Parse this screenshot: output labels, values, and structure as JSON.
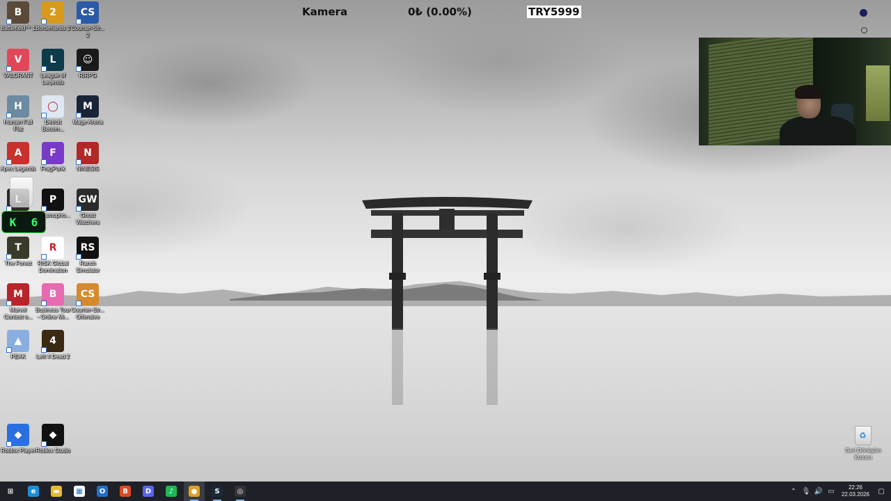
{
  "overlay": {
    "camera_label": "Kamera",
    "balance_text": "0₺ (0.00%)",
    "promo_code": "TRY5999"
  },
  "desktop_icons": [
    {
      "label": "Battlefield™ 1",
      "color": "#5b4a3a",
      "glyph": "B"
    },
    {
      "label": "Borderlands 2",
      "color": "#d89a1c",
      "glyph": "2"
    },
    {
      "label": "Counter-Str... 2",
      "color": "#2a5aa8",
      "glyph": "CS"
    },
    {
      "label": "VALORANT",
      "color": "#e0485a",
      "glyph": "V"
    },
    {
      "label": "League of Legends",
      "color": "#0d3b4a",
      "glyph": "L"
    },
    {
      "label": "RIRPG",
      "color": "#1a1a1a",
      "glyph": "☺"
    },
    {
      "label": "Human Fall Flat",
      "color": "#6c8aa0",
      "glyph": "H"
    },
    {
      "label": "Detroit Becom...",
      "color": "#dfe8f2",
      "glyph": "◯"
    },
    {
      "label": "Mage Arena",
      "color": "#1a2438",
      "glyph": "M"
    },
    {
      "label": "Apex Legends",
      "color": "#c8312c",
      "glyph": "A"
    },
    {
      "label": "FragPunk",
      "color": "#7a3ac8",
      "glyph": "F"
    },
    {
      "label": "NINESIS",
      "color": "#b02828",
      "glyph": "N"
    },
    {
      "label": "",
      "color": "#2a2a2a",
      "glyph": "L"
    },
    {
      "label": "Phasmopho...",
      "color": "#111111",
      "glyph": "P"
    },
    {
      "label": "Ghost Watchers",
      "color": "#2b2b2b",
      "glyph": "GW"
    },
    {
      "label": "The Forest",
      "color": "#3a3a2a",
      "glyph": "T"
    },
    {
      "label": "RISK Global Domination",
      "color": "#ffffff",
      "glyph": "R"
    },
    {
      "label": "Ranch Simulator",
      "color": "#111111",
      "glyph": "RS"
    },
    {
      "label": "Marvel Contest o...",
      "color": "#b8242a",
      "glyph": "M"
    },
    {
      "label": "Business Tour - Online Mi...",
      "color": "#e86ab0",
      "glyph": "B"
    },
    {
      "label": "Counter-Str... Offensive",
      "color": "#d8892c",
      "glyph": "CS"
    },
    {
      "label": "PEAK",
      "color": "#8aaee0",
      "glyph": "▲"
    },
    {
      "label": "Left 4 Dead 2",
      "color": "#3a2a14",
      "glyph": "4"
    },
    {
      "label": "Roblox Player",
      "color": "#2a6fe0",
      "glyph": "◆"
    },
    {
      "label": "Roblox Studio",
      "color": "#111111",
      "glyph": "◆"
    }
  ],
  "keyboard_widget": {
    "key": "K",
    "count": "6"
  },
  "recycle_bin": {
    "label": "Geri Dönüşüm Kutusu"
  },
  "taskbar": {
    "apps": [
      {
        "name": "start-button",
        "glyph": "⊞",
        "color": "#1e2127"
      },
      {
        "name": "edge-icon",
        "glyph": "e",
        "color": "#1f8ed8"
      },
      {
        "name": "file-explorer-icon",
        "glyph": "▬",
        "color": "#e8b830"
      },
      {
        "name": "store-icon",
        "glyph": "▦",
        "color": "#ffffff"
      },
      {
        "name": "outlook-icon",
        "glyph": "O",
        "color": "#1e6fd0"
      },
      {
        "name": "brave-icon",
        "glyph": "B",
        "color": "#e04a20"
      },
      {
        "name": "discord-icon",
        "glyph": "D",
        "color": "#5865f2"
      },
      {
        "name": "spotify-icon",
        "glyph": "♪",
        "color": "#1db954"
      },
      {
        "name": "chrome-icon",
        "glyph": "●",
        "color": "#e0a020"
      },
      {
        "name": "steam-icon",
        "glyph": "S",
        "color": "#1b2838"
      },
      {
        "name": "obs-icon",
        "glyph": "◎",
        "color": "#333333"
      }
    ],
    "time": "22:26",
    "date": "22.03.2026"
  }
}
